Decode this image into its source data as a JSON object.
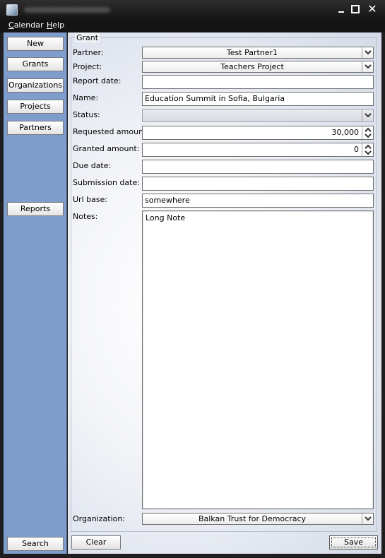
{
  "menu": {
    "calendar": "Calendar",
    "help": "Help"
  },
  "sidebar": {
    "new": "New",
    "grants": "Grants",
    "organizations": "Organizations",
    "projects": "Projects",
    "partners": "Partners",
    "reports": "Reports",
    "search": "Search"
  },
  "form": {
    "group_title": "Grant",
    "partner": {
      "label": "Partner:",
      "value": "Test Partner1"
    },
    "project": {
      "label": "Project:",
      "value": "Teachers Project"
    },
    "report_date": {
      "label": "Report date:",
      "value": ""
    },
    "name": {
      "label": "Name:",
      "value": "Education Summit in Sofia, Bulgaria"
    },
    "status": {
      "label": "Status:",
      "value": ""
    },
    "requested_amount": {
      "label": "Requested amount:",
      "value": "30,000"
    },
    "granted_amount": {
      "label": "Granted amount:",
      "value": "0"
    },
    "due_date": {
      "label": "Due date:",
      "value": ""
    },
    "submission_date": {
      "label": "Submission date:",
      "value": ""
    },
    "url_base": {
      "label": "Url base:",
      "value": "somewhere"
    },
    "notes": {
      "label": "Notes:",
      "value": "Long Note"
    },
    "organization": {
      "label": "Organization:",
      "value": "Balkan Trust for Democracy"
    }
  },
  "actions": {
    "clear": "Clear",
    "save": "Save"
  },
  "icons": {
    "app": "app-icon",
    "minimize": "minimize-icon",
    "maximize": "maximize-icon",
    "close": "close-icon",
    "dropdown": "chevron-down-icon",
    "spin": "spin-up-down-icon"
  }
}
